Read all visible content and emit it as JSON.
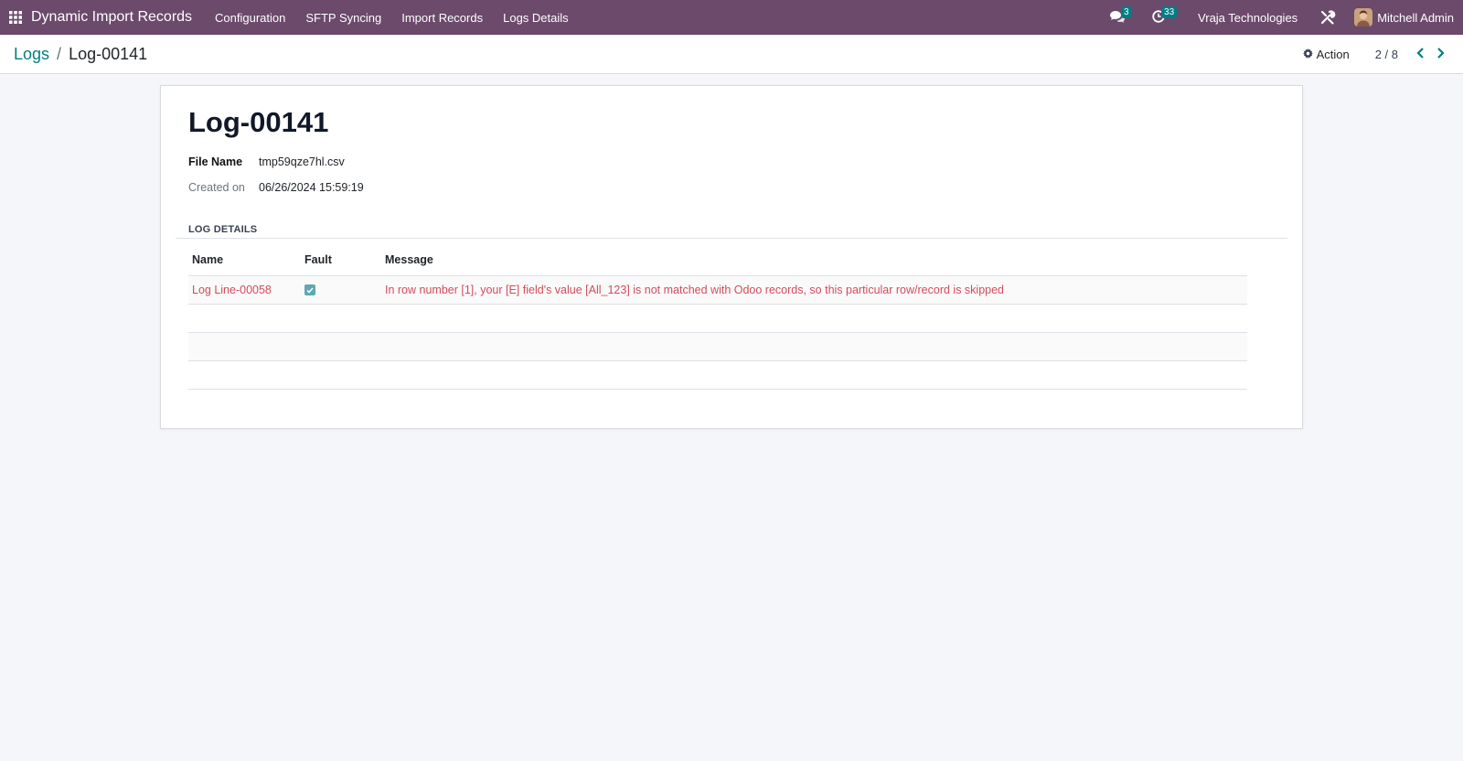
{
  "navbar": {
    "app_name": "Dynamic Import Records",
    "menu": [
      {
        "label": "Configuration"
      },
      {
        "label": "SFTP Syncing"
      },
      {
        "label": "Import Records"
      },
      {
        "label": "Logs Details"
      }
    ],
    "messages_count": "3",
    "activities_count": "33",
    "company": "Vraja Technologies",
    "user": "Mitchell Admin",
    "icons": {
      "apps": "apps-grid-icon",
      "messages": "chat-icon",
      "activities": "clock-icon",
      "debug": "tools-icon"
    },
    "colors": {
      "bg": "#6b4a6b",
      "badge": "#017e84"
    }
  },
  "control_panel": {
    "breadcrumb_parent": "Logs",
    "breadcrumb_current": "Log-00141",
    "action_label": "Action",
    "pager": "2 / 8"
  },
  "record": {
    "title": "Log-00141",
    "fields": [
      {
        "label": "File Name",
        "value": "tmp59qze7hl.csv"
      },
      {
        "label": "Created on",
        "value": "06/26/2024 15:59:19"
      }
    ],
    "section_title": "LOG DETAILS",
    "table": {
      "headers": {
        "name": "Name",
        "fault": "Fault",
        "message": "Message"
      },
      "rows": [
        {
          "name": "Log Line-00058",
          "fault": true,
          "message": "In row number [1], your [E] field's value [All_123] is not matched with Odoo records, so this particular row/record is skipped"
        }
      ]
    }
  }
}
